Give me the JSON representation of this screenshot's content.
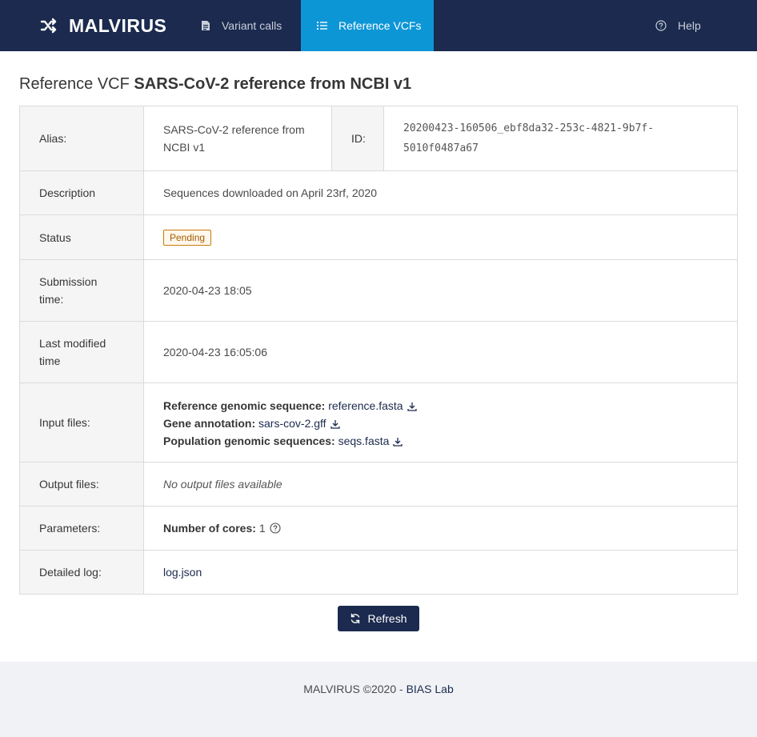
{
  "navbar": {
    "brand": "MALVIRUS",
    "brand_icon": "shuffle-icon",
    "items": [
      {
        "label": "Variant calls",
        "icon": "file-icon"
      },
      {
        "label": "Reference VCFs",
        "icon": "list-icon",
        "active": true
      },
      {
        "label": "Help",
        "icon": "question-circle-icon"
      }
    ],
    "colors": {
      "background": "#1b2a4e",
      "active": "#0d96d6"
    }
  },
  "page": {
    "title_lead": "Reference VCF",
    "title_name": "SARS-CoV-2 reference from NCBI v1"
  },
  "details": {
    "alias_label": "Alias:",
    "alias_value": "SARS-CoV-2 reference from NCBI v1",
    "id_label": "ID:",
    "id_value": "20200423-160506_ebf8da32-253c-4821-9b7f-5010f0487a67",
    "description_label": "Description",
    "description_value": "Sequences downloaded on April 23rf, 2020",
    "status_label": "Status",
    "status_value": "Pending",
    "submission_label": "Submission time:",
    "submission_value": "2020-04-23 18:05",
    "modified_label": "Last modified time",
    "modified_value": "2020-04-23 16:05:06",
    "input_label": "Input files:",
    "input_files": [
      {
        "label": "Reference genomic sequence:",
        "file": "reference.fasta"
      },
      {
        "label": "Gene annotation:",
        "file": "sars-cov-2.gff"
      },
      {
        "label": "Population genomic sequences:",
        "file": "seqs.fasta"
      }
    ],
    "output_label": "Output files:",
    "output_value": "No output files available",
    "parameters_label": "Parameters:",
    "cores_label": "Number of cores:",
    "cores_value": "1",
    "log_label": "Detailed log:",
    "log_value": "log.json"
  },
  "actions": {
    "refresh_label": "Refresh"
  },
  "footer": {
    "text": "MALVIRUS ©2020 -",
    "link": "BIAS Lab"
  }
}
